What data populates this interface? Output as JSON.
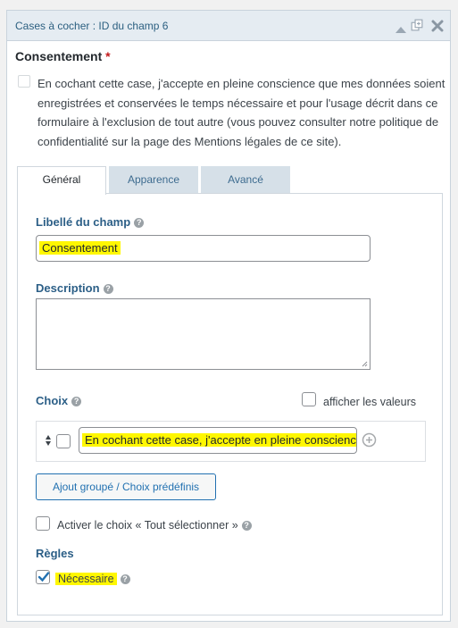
{
  "header": {
    "title": "Cases à cocher : ID du champ 6"
  },
  "field": {
    "label": "Consentement",
    "required_marker": "*",
    "consent_text": "En cochant cette case, j'accepte en pleine conscience que mes données soient enregistrées et conservées le temps nécessaire et pour l'usage décrit dans ce formulaire à l'exclusion de tout autre (vous pouvez consulter notre politique de confidentialité sur la page des Mentions légales de ce site)."
  },
  "tabs": [
    {
      "label": "Général",
      "active": true
    },
    {
      "label": "Apparence",
      "active": false
    },
    {
      "label": "Avancé",
      "active": false
    }
  ],
  "general": {
    "field_label_title": "Libellé du champ",
    "field_label_value": "Consentement",
    "description_title": "Description",
    "description_value": "",
    "choices_title": "Choix",
    "show_values_label": "afficher les valeurs",
    "choice_value": "En cochant cette case, j'accepte en pleine conscience que mes données soient enregistrées",
    "bulk_button": "Ajout groupé / Choix prédéfinis",
    "select_all_label": "Activer le choix « Tout sélectionner »",
    "rules_title": "Règles",
    "required_label": "Nécessaire",
    "required_checked": true,
    "show_values_checked": false,
    "select_all_checked": false
  },
  "colors": {
    "highlight": "#fff700",
    "accent": "#2271b1",
    "required": "#c2191b"
  }
}
